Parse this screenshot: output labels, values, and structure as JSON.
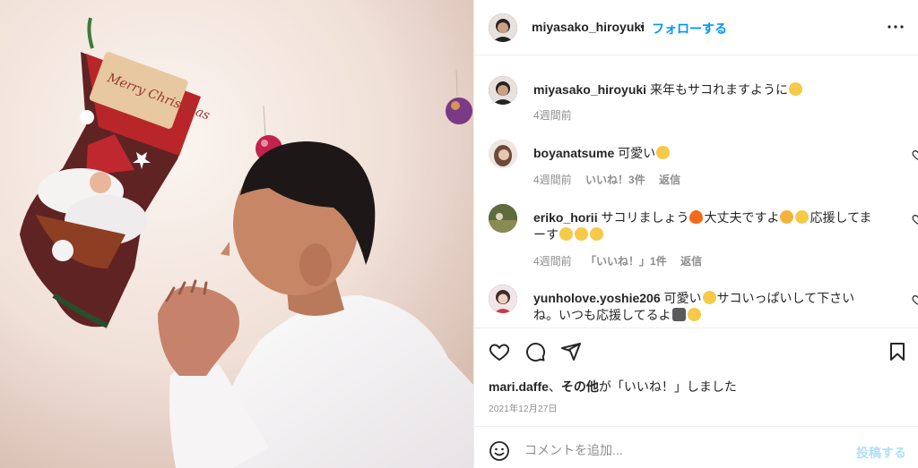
{
  "post": {
    "photo_alt": "Merry Christmas",
    "stocking_text": "Merry Christmas"
  },
  "header": {
    "username": "miyasako_hiroyuki",
    "dot": "•",
    "follow_label": "フォローする",
    "more_icon": "more-horizontal-icon"
  },
  "caption": {
    "username": "miyasako_hiroyuki",
    "text": "来年もサコれますように",
    "emoji": "grinning-face",
    "time": "4週間前"
  },
  "comments": [
    {
      "username": "boyanatsume",
      "text": "可愛い",
      "emoji": "heart-eyes-face",
      "time": "4週間前",
      "likes": "いいね！3件",
      "reply": "返信"
    },
    {
      "username": "eriko_horii",
      "text_1": "サコリましょう",
      "text_2": "大丈夫ですよ",
      "text_3": "応援してまーす",
      "time": "4週間前",
      "likes": "「いいね！」1件",
      "reply": "返信"
    },
    {
      "username": "yunholove.yoshie206",
      "text_1": "可愛い",
      "text_2": "サコいっぱいして下さいね。いつも応援してるよ"
    }
  ],
  "actions": {
    "like_icon": "heart-icon",
    "comment_icon": "comment-icon",
    "share_icon": "paper-plane-icon",
    "save_icon": "bookmark-icon"
  },
  "likes_summary": {
    "user": "mari.daffe",
    "sep": "、",
    "others": "その他",
    "suffix": "が「いいね！」しました"
  },
  "date": "2021年12月27日",
  "composer": {
    "placeholder": "コメントを追加...",
    "post_label": "投稿する"
  },
  "colors": {
    "accent": "#0095f6",
    "post_disabled": "#b2dffc",
    "muted": "#8e8e8e"
  }
}
